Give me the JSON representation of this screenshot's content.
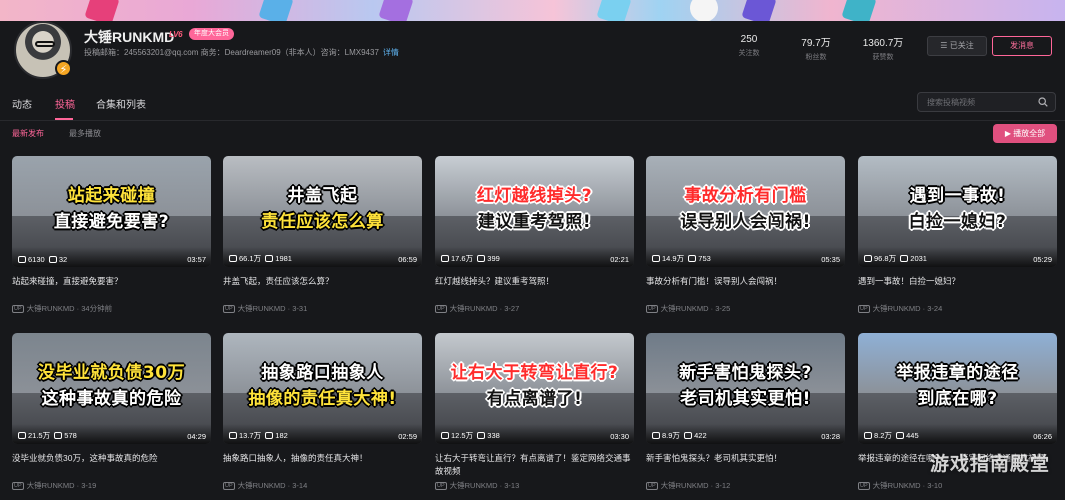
{
  "profile": {
    "name": "大锤RUNKMD",
    "level_badge": "LV6",
    "vip_badge": "年度大会员",
    "contact": "投稿邮箱：245563201@qq.com 商务：Deardreamer09（非本人）咨询：LMX9437",
    "contact_link": "详情",
    "avatar_badge": "⚡"
  },
  "stats": [
    {
      "value": "250",
      "label": "关注数"
    },
    {
      "value": "79.7万",
      "label": "粉丝数"
    },
    {
      "value": "1360.7万",
      "label": "获赞数"
    }
  ],
  "actions": {
    "follow": "☰ 已关注",
    "message": "发消息"
  },
  "tabs": [
    "动态",
    "投稿",
    "合集和列表"
  ],
  "search": {
    "placeholder": "搜索投稿视频"
  },
  "sort": [
    "最新发布",
    "最多播放"
  ],
  "play_all": "▶ 播放全部",
  "videos": [
    {
      "cap1": "站起来碰撞",
      "cap2": "直接避免要害?",
      "plays": "6130",
      "danmaku": "32",
      "duration": "03:57",
      "title": "站起来碰撞，直接避免要害？",
      "author": "大锤RUNKMD",
      "date": "34分钟前",
      "sky": "#9aa3ac",
      "c1color": "#ffe33a",
      "c2color": "#ffffff"
    },
    {
      "cap1": "井盖飞起",
      "cap2": "责任应该怎么算",
      "plays": "66.1万",
      "danmaku": "1981",
      "duration": "06:59",
      "title": "井盖飞起，责任应该怎么算？",
      "author": "大锤RUNKMD",
      "date": "3-31",
      "sky": "#b9bdc2",
      "c1color": "#ffffff",
      "c2color": "#ffe33a"
    },
    {
      "cap1": "红灯越线掉头?",
      "cap2": "建议重考驾照!",
      "plays": "17.6万",
      "danmaku": "399",
      "duration": "02:21",
      "title": "红灯越线掉头？建议重考驾照！",
      "author": "大锤RUNKMD",
      "date": "3-27",
      "sky": "#c7cdd3",
      "c1color": "#ff2b2b",
      "c2color": "#111111"
    },
    {
      "cap1": "事故分析有门槛",
      "cap2": "误导别人会闯祸!",
      "plays": "14.9万",
      "danmaku": "753",
      "duration": "05:35",
      "title": "事故分析有门槛！误导别人会闯祸！",
      "author": "大锤RUNKMD",
      "date": "3-25",
      "sky": "#a8b0b8",
      "c1color": "#ff2b2b",
      "c2color": "#111111"
    },
    {
      "cap1": "遇到一事故!",
      "cap2": "白捡一媳妇?",
      "plays": "96.8万",
      "danmaku": "2031",
      "duration": "05:29",
      "title": "遇到一事故！白捡一媳妇？",
      "author": "大锤RUNKMD",
      "date": "3-24",
      "sky": "#b3bcc4",
      "c1color": "#ffffff",
      "c2color": "#111111"
    },
    {
      "cap1": "没毕业就负债30万",
      "cap2": "这种事故真的危险",
      "plays": "21.5万",
      "danmaku": "578",
      "duration": "04:29",
      "title": "没毕业就负债30万，这种事故真的危险",
      "author": "大锤RUNKMD",
      "date": "3-19",
      "sky": "#7c858e",
      "c1color": "#ffe33a",
      "c2color": "#ffffff"
    },
    {
      "cap1": "抽象路口抽象人",
      "cap2": "抽像的责任真大神!",
      "plays": "13.7万",
      "danmaku": "182",
      "duration": "02:59",
      "title": "抽象路口抽象人，抽像的责任真大神！",
      "author": "大锤RUNKMD",
      "date": "3-14",
      "sky": "#aeb6be",
      "c1color": "#ffffff",
      "c2color": "#ffe33a"
    },
    {
      "cap1": "让右大于转弯让直行?",
      "cap2": "有点离谱了!",
      "plays": "12.5万",
      "danmaku": "338",
      "duration": "03:30",
      "title": "让右大于转弯让直行？有点离谱了！鉴定网络交通事故视频",
      "author": "大锤RUNKMD",
      "date": "3-13",
      "sky": "#c4c9ce",
      "c1color": "#ff2b2b",
      "c2color": "#111111"
    },
    {
      "cap1": "新手害怕鬼探头?",
      "cap2": "老司机其实更怕!",
      "plays": "8.9万",
      "danmaku": "422",
      "duration": "03:28",
      "title": "新手害怕鬼探头？老司机其实更怕！",
      "author": "大锤RUNKMD",
      "date": "3-12",
      "sky": "#6f7b88",
      "c1color": "#ffffff",
      "c2color": "#ffffff"
    },
    {
      "cap1": "举报违章的途径",
      "cap2": "到底在哪?",
      "plays": "8.2万",
      "danmaku": "445",
      "duration": "06:26",
      "title": "举报违章的途径在哪？……鉴定网络交通事故视频",
      "author": "大锤RUNKMD",
      "date": "3-10",
      "sky": "#8fb0d6",
      "c1color": "#ffffff",
      "c2color": "#ffffff"
    }
  ],
  "watermark": "游戏指南殿堂"
}
